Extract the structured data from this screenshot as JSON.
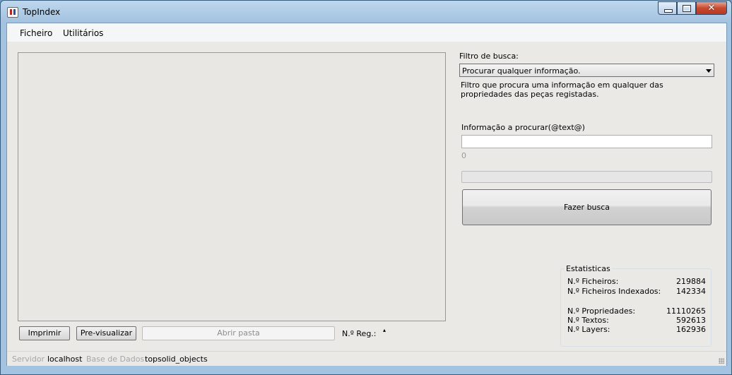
{
  "window": {
    "title": "TopIndex"
  },
  "menu": {
    "items": [
      "Ficheiro",
      "Utilitários"
    ]
  },
  "toolbar": {
    "print_label": "Imprimir",
    "preview_label": "Pre-visualizar",
    "open_folder_label": "Abrir pasta",
    "reg_label": "N.º Reg.:",
    "reg_value": ""
  },
  "search": {
    "filter_label": "Filtro de busca:",
    "filter_selected": "Procurar qualquer informação.",
    "filter_description": "Filtro que procura uma informação em qualquer das propriedades das peças registadas.",
    "info_label": "Informação a procurar(@text@)",
    "info_value": "",
    "count": "0",
    "progress_fraction": 0,
    "button_label": "Fazer busca"
  },
  "stats": {
    "title": "Estatisticas",
    "rows": [
      {
        "label": "N.º Ficheiros:",
        "value": "219884"
      },
      {
        "label": "N.º Ficheiros Indexados:",
        "value": "142334"
      },
      {
        "label": "N.º Propriedades:",
        "value": "11110265"
      },
      {
        "label": "N.º Textos:",
        "value": "592613"
      },
      {
        "label": "N.º Layers:",
        "value": "162936"
      }
    ]
  },
  "status": {
    "server_label": "Servidor",
    "server_value": "localhost",
    "db_label": "Base de Dados",
    "db_value": "topsolid_objects"
  },
  "colors": {
    "titlebar": "#a4c3e0",
    "client": "#ebe9e6",
    "close_button": "#c7492f"
  }
}
